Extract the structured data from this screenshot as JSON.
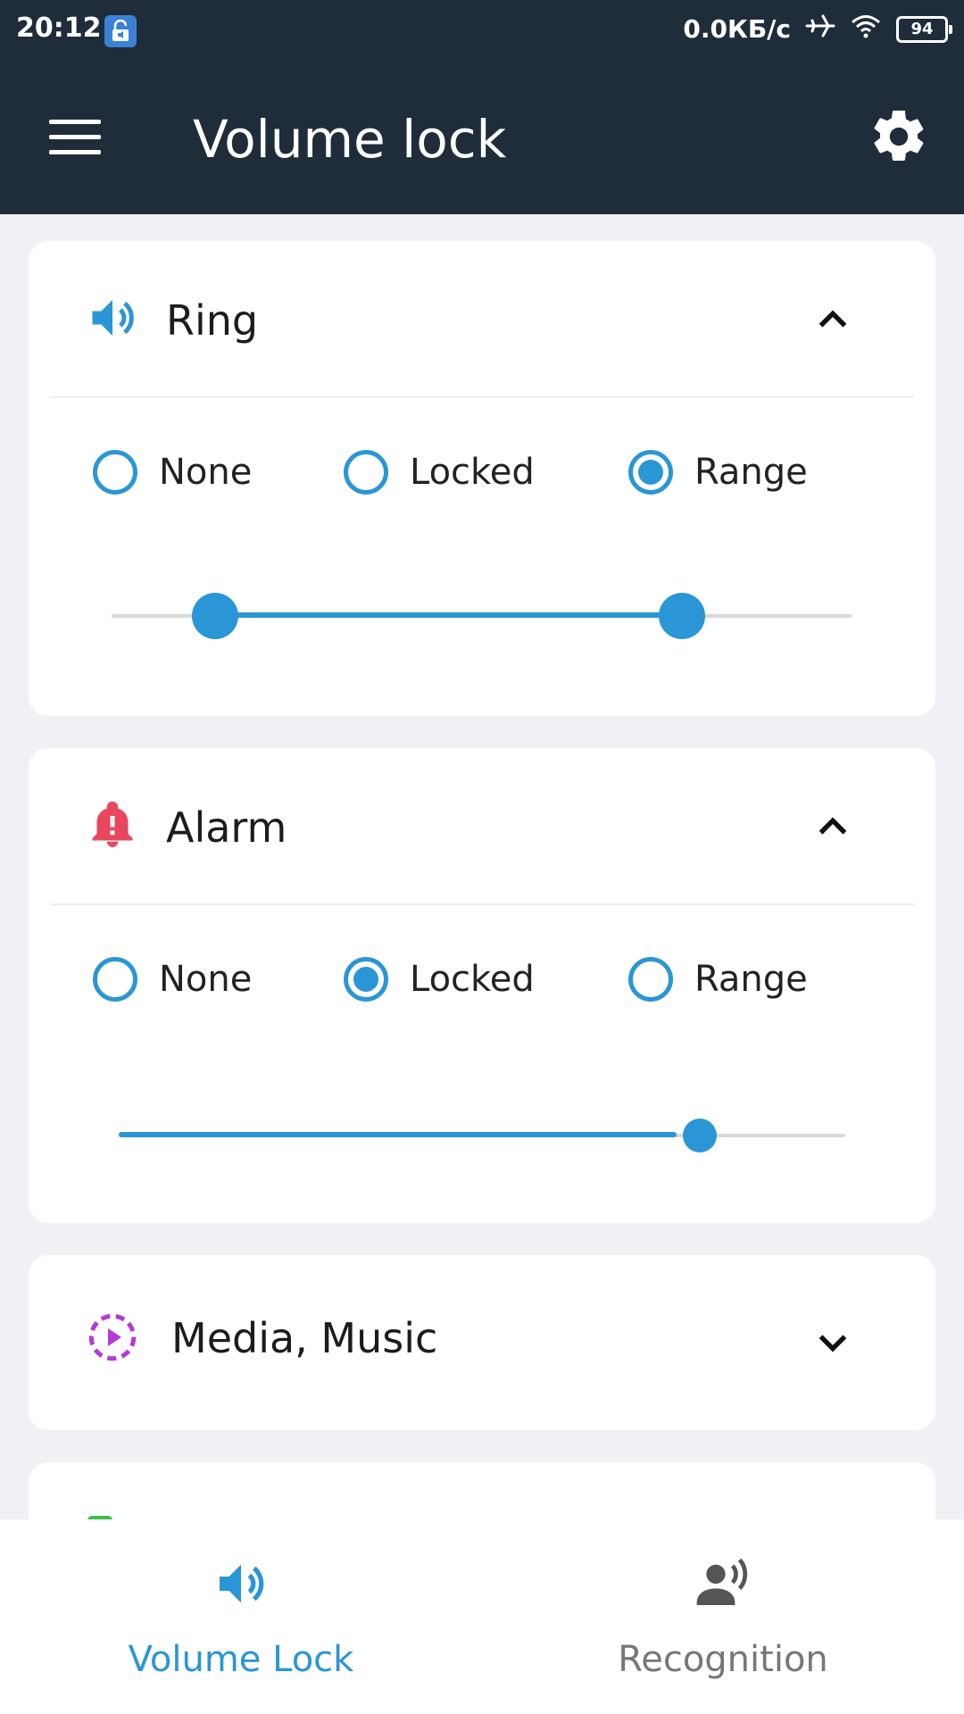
{
  "status": {
    "time": "20:12",
    "network": "0.0КБ/с",
    "battery": "94"
  },
  "appbar": {
    "title": "Volume lock",
    "menu_icon": "hamburger-menu-icon",
    "settings_icon": "gear-icon"
  },
  "cards": [
    {
      "title": "Ring",
      "icon": "speaker-icon",
      "icon_color": "#2b96d6",
      "expanded": true,
      "options": [
        "None",
        "Locked",
        "Range"
      ],
      "selected": "Range",
      "slider": {
        "low": 0.14,
        "high": 0.77
      }
    },
    {
      "title": "Alarm",
      "icon": "alarm-bell-icon",
      "icon_color": "#e8475d",
      "expanded": true,
      "options": [
        "None",
        "Locked",
        "Range"
      ],
      "selected": "Locked",
      "slider": {
        "value": 0.8
      }
    },
    {
      "title": "Media, Music",
      "icon": "media-play-icon",
      "icon_color": "#b23bd6",
      "expanded": false
    }
  ],
  "bottom_nav": {
    "items": [
      {
        "label": "Volume Lock",
        "icon": "speaker-icon",
        "active": true
      },
      {
        "label": "Recognition",
        "icon": "voice-recognition-icon",
        "active": false
      }
    ]
  },
  "colors": {
    "accent": "#2b96d6",
    "appbar": "#1f2d3b",
    "background": "#f0f1f4"
  }
}
